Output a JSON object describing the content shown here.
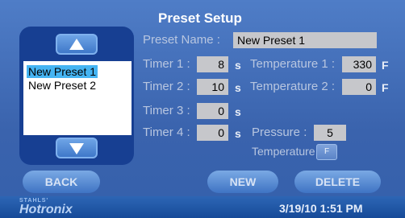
{
  "title": "Preset Setup",
  "list": {
    "up_icon": "up-arrow-icon",
    "down_icon": "down-arrow-icon",
    "items": [
      {
        "label": "New Preset 1",
        "selected": true
      },
      {
        "label": "New Preset 2",
        "selected": false
      }
    ]
  },
  "form": {
    "preset_name_label": "Preset Name :",
    "preset_name_value": "New Preset 1",
    "timer1_label": "Timer 1 :",
    "timer1_value": "8",
    "timer2_label": "Timer 2 :",
    "timer2_value": "10",
    "timer3_label": "Timer 3 :",
    "timer3_value": "0",
    "timer4_label": "Timer 4 :",
    "timer4_value": "0",
    "seconds_unit": "s",
    "temp1_label": "Temperature 1 :",
    "temp1_value": "330",
    "temp2_label": "Temperature 2 :",
    "temp2_value": "0",
    "temp_unit": "F",
    "pressure_label": "Pressure :",
    "pressure_value": "5",
    "temperature_label": "Temperature :",
    "temperature_unit_button": "F"
  },
  "buttons": {
    "back": "BACK",
    "new": "NEW",
    "delete": "DELETE"
  },
  "status": {
    "brand_small": "STAHLS'",
    "brand": "Hotronix",
    "datetime": "3/19/10  1:51 PM"
  },
  "colors": {
    "background": "#3d68b4",
    "selection": "#45b4f2",
    "field": "#c6c7cb"
  }
}
